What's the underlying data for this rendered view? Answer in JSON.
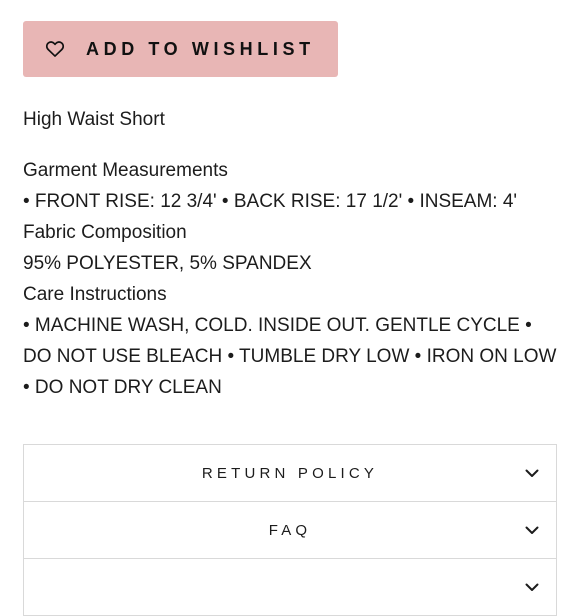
{
  "wishlist": {
    "label": "ADD TO WISHLIST",
    "icon": "heart-outline-icon",
    "background": "#e8b6b5"
  },
  "product": {
    "name": "High Waist Short",
    "sections": [
      {
        "heading": "Garment Measurements",
        "body": "• FRONT RISE: 12 3/4' • BACK RISE: 17 1/2' • INSEAM: 4'"
      },
      {
        "heading": "Fabric Composition",
        "body": "95% POLYESTER, 5% SPANDEX"
      },
      {
        "heading": "Care Instructions",
        "body": "• MACHINE WASH, COLD. INSIDE OUT. GENTLE CYCLE • DO NOT USE BLEACH • TUMBLE DRY LOW • IRON ON LOW • DO NOT DRY CLEAN"
      }
    ]
  },
  "accordion": {
    "items": [
      {
        "label": "RETURN POLICY",
        "icon": "chevron-down-icon"
      },
      {
        "label": "FAQ",
        "icon": "chevron-down-icon"
      },
      {
        "label": "",
        "icon": "chevron-down-icon"
      }
    ]
  }
}
